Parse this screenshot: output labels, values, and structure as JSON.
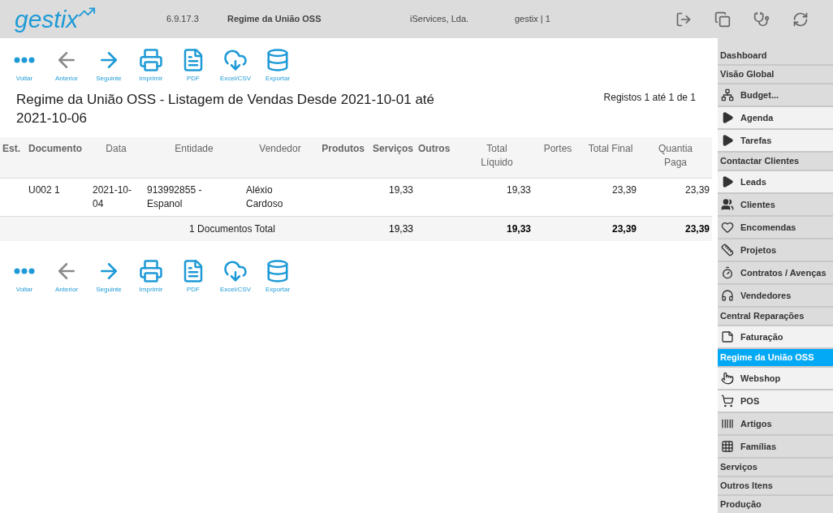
{
  "header": {
    "logo": "gestix",
    "version": "6.9.17.3",
    "module": "Regime da União OSS",
    "company": "iServices, Lda.",
    "user": "gestix | 1"
  },
  "toolbar_top": [
    {
      "label": "Voltar",
      "kind": "dots",
      "disabled": false
    },
    {
      "label": "Anterior",
      "kind": "left",
      "disabled": true
    },
    {
      "label": "Seguinte",
      "kind": "right",
      "disabled": false
    },
    {
      "label": "Imprimir",
      "kind": "print",
      "disabled": false
    },
    {
      "label": "PDF",
      "kind": "pdf",
      "disabled": false
    },
    {
      "label": "Excel/CSV",
      "kind": "cloud",
      "disabled": false
    },
    {
      "label": "Exportar",
      "kind": "db",
      "disabled": false
    }
  ],
  "title": "Regime da União OSS - Listagem de Vendas Desde 2021-10-01 até 2021-10-06",
  "records": "Registos 1 até 1 de 1",
  "table": {
    "columns": [
      {
        "label": "Est.",
        "bold": true
      },
      {
        "label": "Documento",
        "bold": true
      },
      {
        "label": "Data",
        "bold": false
      },
      {
        "label": "Entidade",
        "bold": false
      },
      {
        "label": "Vendedor",
        "bold": false
      },
      {
        "label": "Produtos",
        "bold": true
      },
      {
        "label": "Serviços",
        "bold": true
      },
      {
        "label": "Outros",
        "bold": true
      },
      {
        "label": "Total Líquido",
        "bold": false
      },
      {
        "label": "Portes",
        "bold": false
      },
      {
        "label": "Total Final",
        "bold": false
      },
      {
        "label": "Quantia Paga",
        "bold": false
      }
    ],
    "rows": [
      [
        "",
        "U002 1",
        "2021-10-04",
        "913992855 - Espanol",
        "Aléxio Cardoso",
        "",
        "19,33",
        "",
        "19,33",
        "",
        "23,39",
        "23,39"
      ]
    ],
    "total": {
      "label": "1 Documentos Total",
      "servicos": "19,33",
      "liquido": "19,33",
      "final": "23,39",
      "paga": "23,39"
    }
  },
  "toolbar_bottom": [
    {
      "label": "Voltar",
      "kind": "dots",
      "disabled": false
    },
    {
      "label": "Anterior",
      "kind": "left",
      "disabled": true
    },
    {
      "label": "Seguinte",
      "kind": "right",
      "disabled": false
    },
    {
      "label": "Imprimir",
      "kind": "print",
      "disabled": false
    },
    {
      "label": "PDF",
      "kind": "pdf",
      "disabled": false
    },
    {
      "label": "Excel/CSV",
      "kind": "cloud",
      "disabled": false
    },
    {
      "label": "Exportar",
      "kind": "db",
      "disabled": false
    }
  ],
  "sidebar": {
    "items": [
      {
        "label": "Dashboard",
        "kind": "header",
        "highlighted": false,
        "selected": false
      },
      {
        "label": "Visão Global",
        "kind": "header",
        "highlighted": false,
        "selected": false
      },
      {
        "label": "Budget...",
        "kind": "org",
        "highlighted": false,
        "selected": false
      },
      {
        "label": "Agenda",
        "kind": "play",
        "highlighted": true,
        "selected": false
      },
      {
        "label": "Tarefas",
        "kind": "play",
        "highlighted": true,
        "selected": false
      },
      {
        "label": "Contactar Clientes",
        "kind": "header",
        "highlighted": false,
        "selected": false
      },
      {
        "label": "Leads",
        "kind": "play",
        "highlighted": true,
        "selected": false
      },
      {
        "label": "Clientes",
        "kind": "people",
        "highlighted": false,
        "selected": false
      },
      {
        "label": "Encomendas",
        "kind": "heart",
        "highlighted": false,
        "selected": false
      },
      {
        "label": "Projetos",
        "kind": "ruler",
        "highlighted": false,
        "selected": false
      },
      {
        "label": "Contratos / Avenças",
        "kind": "timer",
        "highlighted": false,
        "selected": false
      },
      {
        "label": "Vendedores",
        "kind": "headset",
        "highlighted": false,
        "selected": false
      },
      {
        "label": "Central Reparações",
        "kind": "header",
        "highlighted": false,
        "selected": false
      },
      {
        "label": "Faturação",
        "kind": "doc",
        "highlighted": true,
        "selected": false
      },
      {
        "label": "Regime da União OSS",
        "kind": "header",
        "selected": true
      },
      {
        "label": "Webshop",
        "kind": "hand",
        "highlighted": true,
        "selected": false
      },
      {
        "label": "POS",
        "kind": "cart",
        "highlighted": true,
        "selected": false
      },
      {
        "label": "Artigos",
        "kind": "barcode",
        "highlighted": false,
        "selected": false
      },
      {
        "label": "Famílias",
        "kind": "grid",
        "highlighted": false,
        "selected": false
      },
      {
        "label": "Serviços",
        "kind": "header",
        "highlighted": false,
        "selected": false
      },
      {
        "label": "Outros Itens",
        "kind": "header",
        "highlighted": false,
        "selected": false
      },
      {
        "label": "Produção",
        "kind": "header",
        "highlighted": false,
        "selected": false
      }
    ]
  }
}
